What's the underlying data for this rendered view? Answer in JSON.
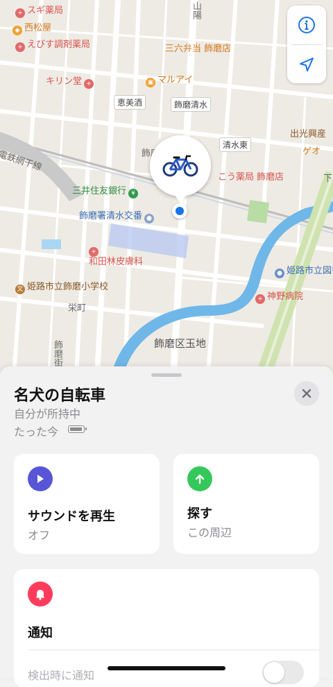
{
  "map": {
    "labels": {
      "sugi": "スギ薬局",
      "nishimatsuya": "西松屋",
      "ebisu": "えびす調剤薬局",
      "kirindo": "キリン堂",
      "keibishu": "恵美酒",
      "sanroku": "三六弁当 飾磨店",
      "marui": "マルアイ",
      "shikama_shimizu": "飾磨清水",
      "shimizu_higashi": "清水東",
      "idemitsu": "出光興産",
      "geo": "ゲオ",
      "yakkyoku_shikama": "こう薬局 飾磨店",
      "shimo": "下",
      "smbc": "三井住友銀行",
      "koban": "飾磨署清水交番",
      "wada": "和田林皮膚科",
      "library": "姫路市立図書",
      "jinno": "神野病院",
      "school": "姫路市立飾磨小学校",
      "sakaemachi": "栄町",
      "tamachi": "飾磨区玉地",
      "railway": "電鉄網干線",
      "road_top": "山陽",
      "road_shikama": "飾磨",
      "road_left": "飾磨街"
    },
    "controls": {
      "info_icon": "info-icon",
      "location_icon": "location-arrow-icon"
    },
    "device_icon": "bicycle-icon"
  },
  "sheet": {
    "title": "名犬の自転車",
    "owner": "自分が所持中",
    "time": "たった今",
    "cards": {
      "sound": {
        "label": "サウンドを再生",
        "value": "オフ",
        "icon": "play-icon",
        "color": "#5856d6"
      },
      "find": {
        "label": "探す",
        "value": "この周辺",
        "icon": "arrow-up-icon",
        "color": "#34c759"
      },
      "notify": {
        "label": "通知",
        "row_label": "検出時に通知",
        "toggle": "off",
        "icon": "bell-icon",
        "color": "#ff3b5c"
      }
    }
  }
}
